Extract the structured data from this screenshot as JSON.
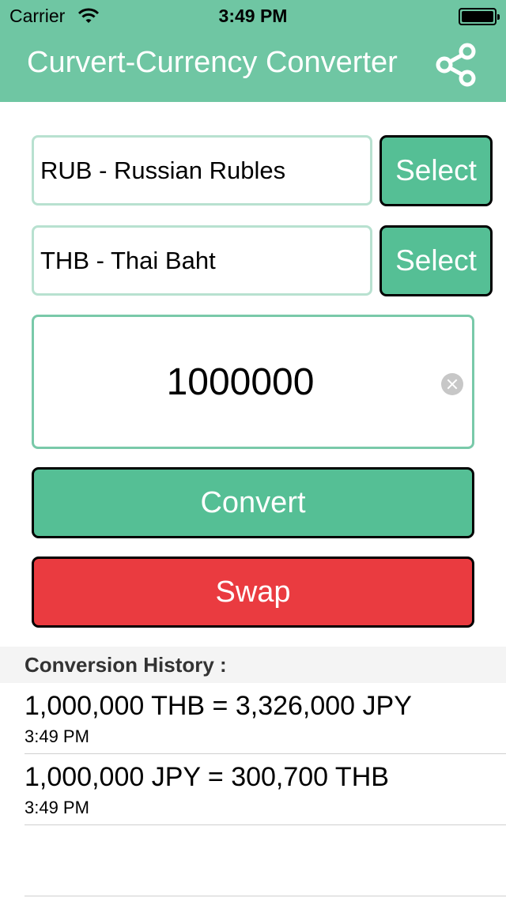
{
  "status_bar": {
    "carrier": "Carrier",
    "time": "3:49 PM"
  },
  "nav": {
    "title": "Curvert-Currency Converter",
    "share_icon": "share-icon"
  },
  "converter": {
    "from_currency": "RUB - Russian Rubles",
    "to_currency": "THB - Thai Baht",
    "select_label": "Select",
    "amount": "1000000",
    "convert_label": "Convert",
    "swap_label": "Swap"
  },
  "history": {
    "header": "Conversion History :",
    "items": [
      {
        "text": "1,000,000 THB = 3,326,000 JPY",
        "time": "3:49 PM"
      },
      {
        "text": "1,000,000 JPY = 300,700 THB",
        "time": "3:49 PM"
      }
    ]
  },
  "colors": {
    "nav_bar": "#6fc6a3",
    "primary_button": "#55bf95",
    "swap_button": "#ea3b40",
    "field_border": "#b8e1d0"
  }
}
